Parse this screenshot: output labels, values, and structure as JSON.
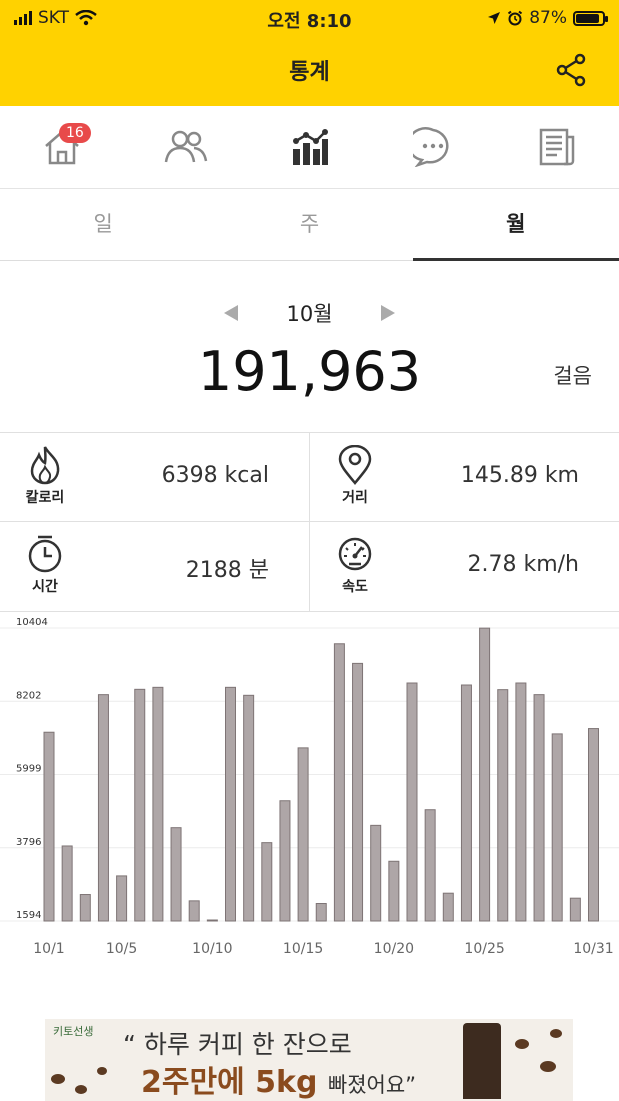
{
  "status_bar": {
    "carrier": "SKT",
    "time": "오전 8:10",
    "battery": "87%",
    "battery_level": 0.87
  },
  "header": {
    "title": "통계",
    "share_icon": "share-icon"
  },
  "nav": {
    "tabs": [
      {
        "icon": "home-icon",
        "badge": "16"
      },
      {
        "icon": "friends-icon"
      },
      {
        "icon": "stats-icon",
        "active": true
      },
      {
        "icon": "chat-icon"
      },
      {
        "icon": "news-icon"
      }
    ]
  },
  "period_tabs": [
    {
      "label": "일"
    },
    {
      "label": "주"
    },
    {
      "label": "월",
      "active": true
    }
  ],
  "summary": {
    "month": "10월",
    "total_steps": "191,963",
    "steps_unit": "걸음"
  },
  "stats": {
    "calories": {
      "label": "칼로리",
      "value": "6398 kcal",
      "icon": "flame-icon"
    },
    "distance": {
      "label": "거리",
      "value": "145.89 km",
      "icon": "location-pin-icon"
    },
    "time": {
      "label": "시간",
      "value": "2188 분",
      "icon": "stopwatch-icon"
    },
    "speed": {
      "label": "속도",
      "value": "2.78 km/h",
      "icon": "speedometer-icon"
    }
  },
  "chart_data": {
    "type": "bar",
    "bar_color": "#aea6a7",
    "y_ticks": [
      "10404",
      "8202",
      "5999",
      "3796",
      "1594"
    ],
    "ylim": [
      1594,
      10404
    ],
    "x_tick_labels": [
      {
        "day": 1,
        "label": "10/1"
      },
      {
        "day": 5,
        "label": "10/5"
      },
      {
        "day": 10,
        "label": "10/10"
      },
      {
        "day": 15,
        "label": "10/15"
      },
      {
        "day": 20,
        "label": "10/20"
      },
      {
        "day": 25,
        "label": "10/25"
      },
      {
        "day": 31,
        "label": "10/31"
      }
    ],
    "categories": [
      "1",
      "2",
      "3",
      "4",
      "5",
      "6",
      "7",
      "8",
      "9",
      "10",
      "11",
      "12",
      "13",
      "14",
      "15",
      "16",
      "17",
      "18",
      "19",
      "20",
      "21",
      "22",
      "23",
      "24",
      "25",
      "26",
      "27",
      "28",
      "29",
      "30",
      "31"
    ],
    "values": [
      7270,
      3850,
      2390,
      8400,
      2950,
      8560,
      8620,
      4400,
      2200,
      1610,
      8620,
      8380,
      3950,
      5210,
      6800,
      2120,
      9930,
      9340,
      4470,
      3390,
      8750,
      4940,
      2430,
      8690,
      10400,
      8550,
      8750,
      8400,
      7220,
      2280,
      7380
    ]
  },
  "ad": {
    "brand": "키토선생",
    "line1": "하루 커피 한 잔으로",
    "line2_main": "2주만에 5kg",
    "line2_end": "빠졌어요"
  }
}
